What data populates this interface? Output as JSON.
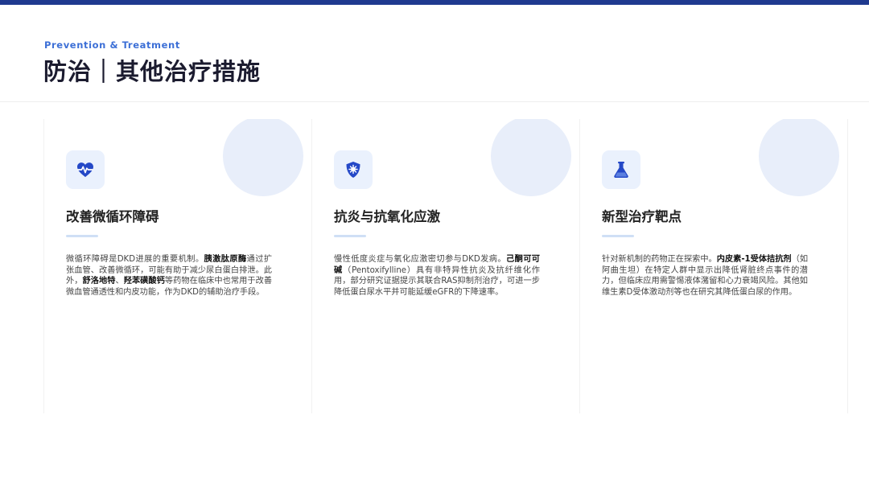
{
  "header": {
    "subtitle": "Prevention & Treatment",
    "title": "防治｜其他治疗措施"
  },
  "colors": {
    "accent": "#1f3a8f",
    "subtitle": "#3c6fd6",
    "icon": "#2448c7",
    "circle": "#e8eefa"
  },
  "cards": [
    {
      "icon": "heartbeat-icon",
      "title": "改善微循环障碍",
      "body": [
        {
          "t": " 微循环障碍是DKD进展的重要机制。"
        },
        {
          "t": "胰激肽原酶",
          "b": true
        },
        {
          "t": "通过扩张血管、改善微循环，可能有助于减少尿白蛋白排泄。此外，"
        },
        {
          "t": "舒洛地特",
          "b": true
        },
        {
          "t": "、"
        },
        {
          "t": "羟苯磺酸钙",
          "b": true
        },
        {
          "t": "等药物在临床中也常用于改善微血管通透性和内皮功能，作为DKD的辅助治疗手段。"
        }
      ]
    },
    {
      "icon": "shield-virus-icon",
      "title": "抗炎与抗氧化应激",
      "body": [
        {
          "t": " 慢性低度炎症与氧化应激密切参与DKD发病。"
        },
        {
          "t": "己酮可可碱",
          "b": true
        },
        {
          "t": "（Pentoxifylline）具有非特异性抗炎及抗纤维化作用，部分研究证据提示其联合RAS抑制剂治疗，可进一步降低蛋白尿水平并可能延缓eGFR的下降速率。"
        }
      ]
    },
    {
      "icon": "flask-icon",
      "title": "新型治疗靶点",
      "body": [
        {
          "t": " 针对新机制的药物正在探索中。"
        },
        {
          "t": "内皮素-1受体拮抗剂",
          "b": true
        },
        {
          "t": "（如阿曲生坦）在特定人群中显示出降低肾脏终点事件的潜力，但临床应用需警惕液体潴留和心力衰竭风险。其他如维生素D受体激动剂等也在研究其降低蛋白尿的作用。"
        }
      ]
    }
  ]
}
